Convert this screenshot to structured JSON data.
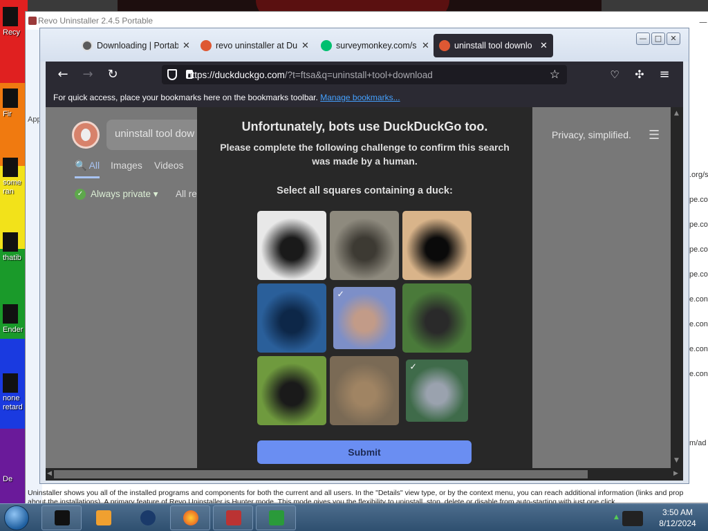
{
  "desktop": {
    "icons": [
      {
        "label": "Recy",
        "top": 0
      },
      {
        "label": "Fir",
        "top": 0
      },
      {
        "label": "some ran",
        "top": 0
      },
      {
        "label": "thatib",
        "top": 0
      },
      {
        "label": "Ender",
        "top": 0
      },
      {
        "label": "none retard",
        "top": 0
      },
      {
        "label": "De",
        "top": 0
      }
    ]
  },
  "revo": {
    "title": "Revo Uninstaller 2.4.5 Portable",
    "app_label": "App",
    "right_column": [
      ".org/s",
      "pe.con",
      "pe.con",
      "pe.con",
      "pe.con",
      "e.con",
      "e.con",
      "e.con",
      "e.con"
    ],
    "right_extra": "m/ad",
    "status_line1": "Uninstaller shows you all of the installed programs and components for both the current and all users. In the \"Details\" view type, or by the context menu, you can reach additional information (links and prop",
    "status_line2": "about the installations). A primary feature of Revo Uninstaller is Hunter mode. This mode gives you the flexibility to uninstall, stop, delete or disable from auto-starting with just one click."
  },
  "browser": {
    "tabs": [
      {
        "label": "Downloading | Portab",
        "favicon_color": "#5a5a5a"
      },
      {
        "label": "revo uninstaller at Duc",
        "favicon_color": "#de5833"
      },
      {
        "label": "surveymonkey.com/s",
        "favicon_color": "#00bf6f"
      },
      {
        "label": "uninstall tool downlo",
        "favicon_color": "#de5833"
      }
    ],
    "url_host": "https://duckduckgo.com",
    "url_rest": "/?t=ftsa&q=uninstall+tool+download",
    "bookmarks_text": "For quick access, place your bookmarks here on the bookmarks toolbar.",
    "bookmarks_link": "Manage bookmarks..."
  },
  "ddg": {
    "search_value": "uninstall tool dow",
    "tabs": [
      "All",
      "Images",
      "Videos"
    ],
    "always_private": "Always private ▾",
    "all_regions": "All re",
    "privacy": "Privacy, simplified."
  },
  "challenge": {
    "title": "Unfortunately, bots use DuckDuckGo too.",
    "prompt": "Please complete the following challenge to confirm this search was made by a human.",
    "instruction": "Select all squares containing a duck:",
    "tiles": [
      {
        "name": "penguin-tile",
        "selected": false,
        "colors": [
          "#e8e8e8",
          "#1a1a1a"
        ]
      },
      {
        "name": "tree-animal-tile",
        "selected": false,
        "colors": [
          "#8e8a7e",
          "#3d3a33"
        ]
      },
      {
        "name": "monkey-face-tile",
        "selected": false,
        "colors": [
          "#d9b48a",
          "#0a0a0a"
        ]
      },
      {
        "name": "duck-water-tile",
        "selected": false,
        "colors": [
          "#2a5f9a",
          "#0d2748"
        ]
      },
      {
        "name": "duck-swimming-tile",
        "selected": true,
        "colors": [
          "#7d8fc8",
          "#c29b88"
        ]
      },
      {
        "name": "bird-grass-tile",
        "selected": false,
        "colors": [
          "#4a7a3a",
          "#2a2a2a"
        ]
      },
      {
        "name": "monkey-grass-tile",
        "selected": false,
        "colors": [
          "#6f9a3e",
          "#1a1a1a"
        ]
      },
      {
        "name": "deer-tile",
        "selected": false,
        "colors": [
          "#7a6a55",
          "#a08463"
        ]
      },
      {
        "name": "mallard-tile",
        "selected": true,
        "colors": [
          "#3f6b4a",
          "#9aa2ae"
        ]
      }
    ],
    "submit": "Submit"
  },
  "taskbar": {
    "time": "3:50 AM",
    "date": "8/12/2024"
  }
}
